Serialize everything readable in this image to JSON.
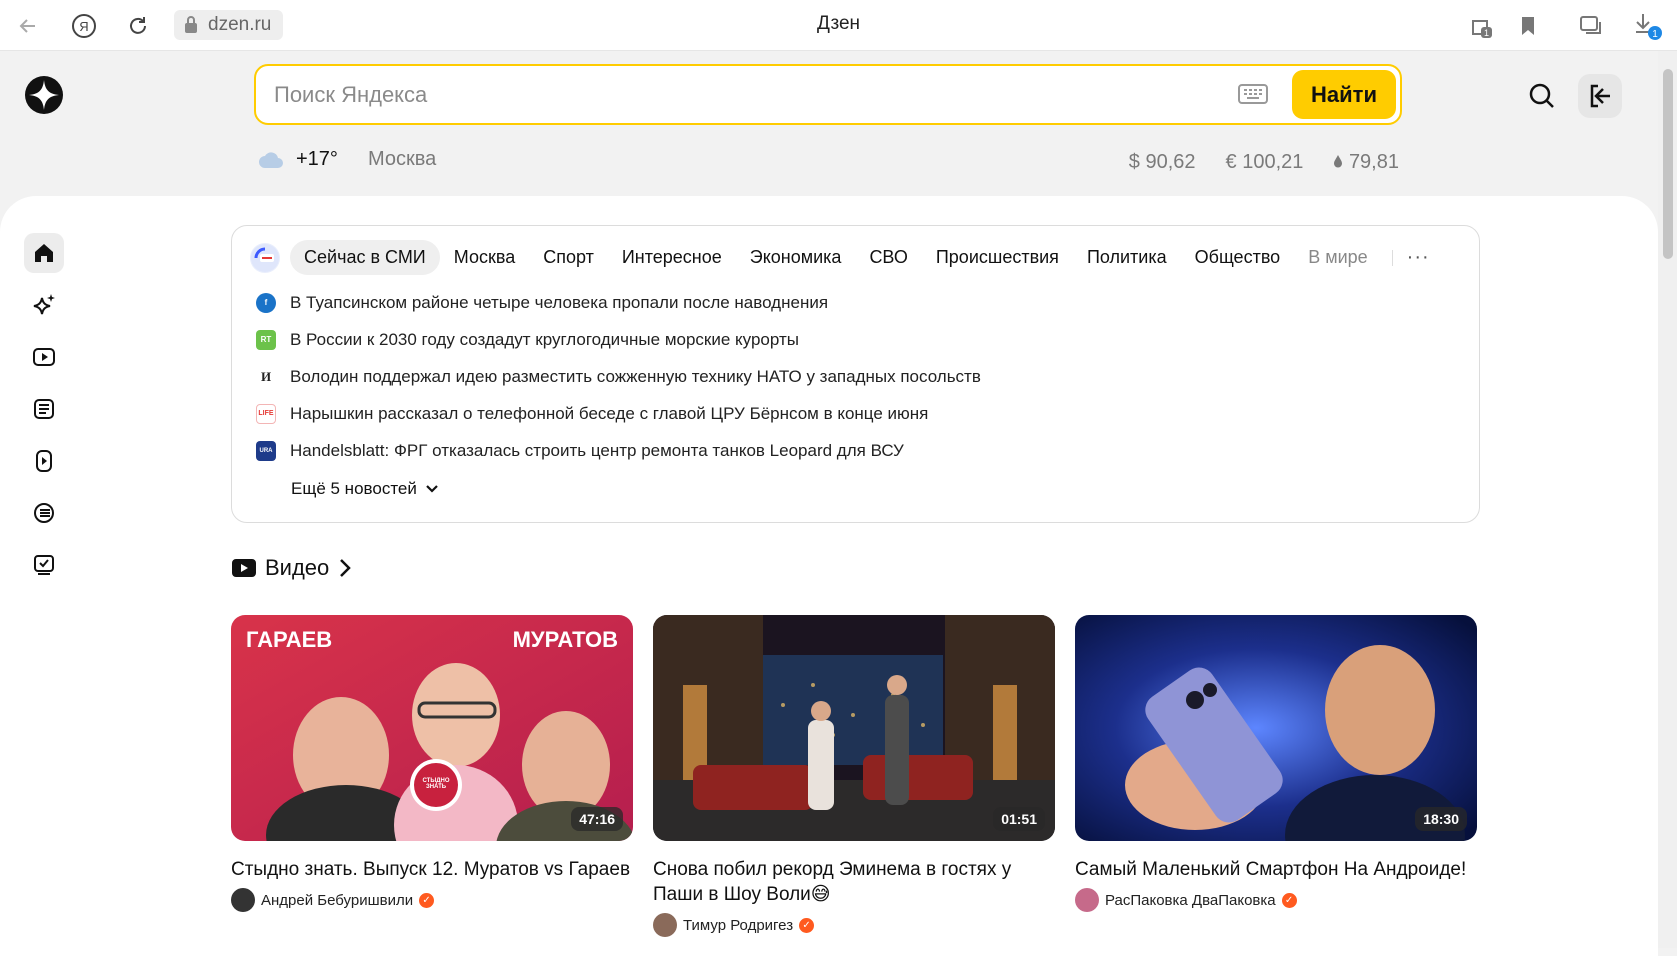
{
  "browser": {
    "url": "dzen.ru",
    "page_title": "Дзен",
    "downloads_badge": "1",
    "tabs_badge": "1"
  },
  "search": {
    "placeholder": "Поиск Яндекса",
    "button": "Найти"
  },
  "weather": {
    "temp": "+17°",
    "city": "Москва"
  },
  "rates": {
    "usd": "$ 90,62",
    "eur": "€ 100,21",
    "oil": "79,81"
  },
  "news": {
    "tabs": [
      "Сейчас в СМИ",
      "Москва",
      "Спорт",
      "Интересное",
      "Экономика",
      "СВО",
      "Происшествия",
      "Политика",
      "Общество",
      "В мире"
    ],
    "items": [
      {
        "source_icon": "f-source-icon",
        "color": "#1a73c8",
        "label": "f",
        "text": "В Туапсинском районе четыре человека пропали после наводнения"
      },
      {
        "source_icon": "rt-source-icon",
        "color": "#6cc24a",
        "label": "RT",
        "text": "В России к 2030 году создадут круглогодичные морские курорты"
      },
      {
        "source_icon": "izvestia-source-icon",
        "color": "#ffffff",
        "label": "И",
        "text": "Володин поддержал идею разместить сожженную технику НАТО у западных посольств"
      },
      {
        "source_icon": "life-source-icon",
        "color": "#ffffff",
        "label": "LIFE",
        "text": "Нарышкин рассказал о телефонной беседе с главой ЦРУ Бёрнсом в конце июня"
      },
      {
        "source_icon": "ura-source-icon",
        "color": "#1e3b8a",
        "label": "URA.RU",
        "text": "Handelsblatt: ФРГ отказалась строить центр ремонта танков Leopard для ВСУ"
      }
    ],
    "more": "Ещё 5 новостей"
  },
  "video": {
    "section_title": "Видео",
    "cards": [
      {
        "title": "Стыдно знать. Выпуск 12. Муратов vs Гараев",
        "duration": "47:16",
        "author": "Андрей Бебуришвили",
        "thumb_text_left": "ГАРАЕВ",
        "thumb_text_right": "МУРАТОВ",
        "thumb_badge": "СТЫДНО ЗНАТЬ"
      },
      {
        "title": "Снова побил рекорд Эминема в гостях у Паши в Шоу Воли😅",
        "duration": "01:51",
        "author": "Тимур Родригез"
      },
      {
        "title": "Самый Маленький Смартфон На Андроиде!",
        "duration": "18:30",
        "author": "РасПаковка ДваПаковка"
      }
    ]
  },
  "colors": {
    "accent": "#ffcc00",
    "verify": "#ff5a1f"
  }
}
